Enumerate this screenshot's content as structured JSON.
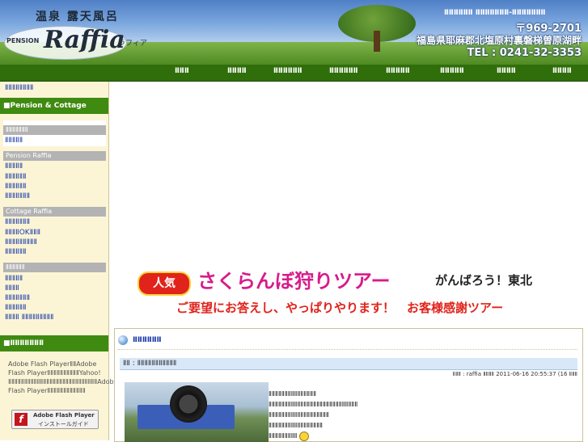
{
  "header": {
    "logo_tag": "温泉 露天風呂",
    "logo_pension": "PENSION",
    "logo_main": "Raffia",
    "logo_kana": "ラフィア",
    "tagline": "ⅡⅡⅡⅡⅡⅡ ⅡⅡⅡⅡⅡⅡⅡ-ⅡⅡⅡⅡⅡⅡⅡ",
    "zip": "〒969-2701",
    "address": "福島県耶麻郡北塩原村裏磐梯曽原湖畔",
    "tel": "TEL : 0241-32-3353"
  },
  "nav": {
    "items": [
      "ⅡⅡⅡ",
      "ⅡⅡⅡⅡ",
      "ⅡⅡⅡⅡⅡⅡ",
      "ⅡⅡⅡⅡⅡⅡ",
      "ⅡⅡⅡⅡⅡ",
      "ⅡⅡⅡⅡⅡ",
      "ⅡⅡⅡⅡ",
      "ⅡⅡⅡⅡ"
    ]
  },
  "sidebar": {
    "top_link": "ⅡⅡⅡⅡⅡⅡⅡⅡ",
    "section_pension_cottage": "■Pension & Cottage",
    "group1_header": "ⅡⅡⅡⅡⅡⅡⅡ",
    "group1_links": [
      "ⅡⅡⅡⅡⅡ"
    ],
    "group2_header": "Pension Raffia",
    "group2_links": [
      "ⅡⅡⅡⅡⅡ",
      "ⅡⅡⅡⅡⅡⅡ",
      "ⅡⅡⅡⅡⅡⅡ",
      "ⅡⅡⅡⅡⅡⅡⅡ"
    ],
    "group3_header": "Cottage Raffia",
    "group3_links": [
      "ⅡⅡⅡⅡⅡⅡⅡ",
      "ⅡⅡⅡⅡOKⅡⅡⅡ",
      "ⅡⅡⅡⅡⅡⅡⅡⅡⅡ",
      "ⅡⅡⅡⅡⅡⅡ"
    ],
    "group4_header": "ⅡⅡⅡⅡⅡⅡ",
    "group4_links": [
      "ⅡⅡⅡⅡⅡ",
      "ⅡⅡⅡⅡ",
      "ⅡⅡⅡⅡⅡⅡⅡ",
      "ⅡⅡⅡⅡⅡⅡ",
      "ⅡⅡⅡⅡ ⅡⅡⅡⅡⅡⅡⅡⅡⅡ"
    ],
    "section_bottom": "■ⅡⅡⅡⅡⅡⅡⅡ",
    "flash_text": "Adobe Flash PlayerⅡⅡAdobe Flash PlayerⅡⅡⅡⅡⅡⅡⅡⅡⅡⅡYahoo!ⅡⅡⅡⅡⅡⅡⅡⅡⅡⅡⅡⅡⅡⅡⅡⅡⅡⅡⅡⅡⅡⅡⅡⅡⅡⅡⅡⅡAdobe Flash PlayerⅡⅡⅡⅡⅡⅡⅡⅡⅡⅡⅡⅡ",
    "flash_badge_line1": "Adobe Flash Player",
    "flash_badge_line2": "インストールガイド",
    "flash_badge_icon": "f"
  },
  "banner": {
    "badge": "人気",
    "title": "さくらんぼ狩りツアー",
    "sub": "がんばろう！東北",
    "line2": "ご要望にお答えし、やっぱりやります！　お客様感謝ツアー"
  },
  "panel": {
    "title": "ⅡⅡⅡⅡⅡⅡ",
    "entry_title": "ⅡⅡ : ⅡⅡⅡⅡⅡⅡⅡⅡⅡⅡⅡ",
    "entry_meta": "ⅡⅡⅡ : raffia ⅡⅡⅡⅡ 2011-06-16 20:55:37 (16 ⅡⅡⅡ",
    "entry_lines": [
      "ⅡⅡⅡⅡⅡⅡⅡⅡⅡⅡⅡⅡⅡⅡⅡ",
      "ⅡⅡⅡⅡⅡⅡⅡⅡⅡⅡⅡⅡⅡⅡⅡⅡⅡⅡⅡⅡⅡⅡⅡⅡⅡⅡⅡⅡ",
      "ⅡⅡⅡⅡⅡⅡⅡⅡⅡⅡⅡⅡⅡⅡⅡⅡⅡⅡⅡ",
      "ⅡⅡⅡⅡⅡⅡⅡⅡⅡⅡⅡⅡⅡⅡⅡⅡⅡ",
      "ⅡⅡⅡⅡⅡⅡⅡⅡⅡ"
    ]
  }
}
